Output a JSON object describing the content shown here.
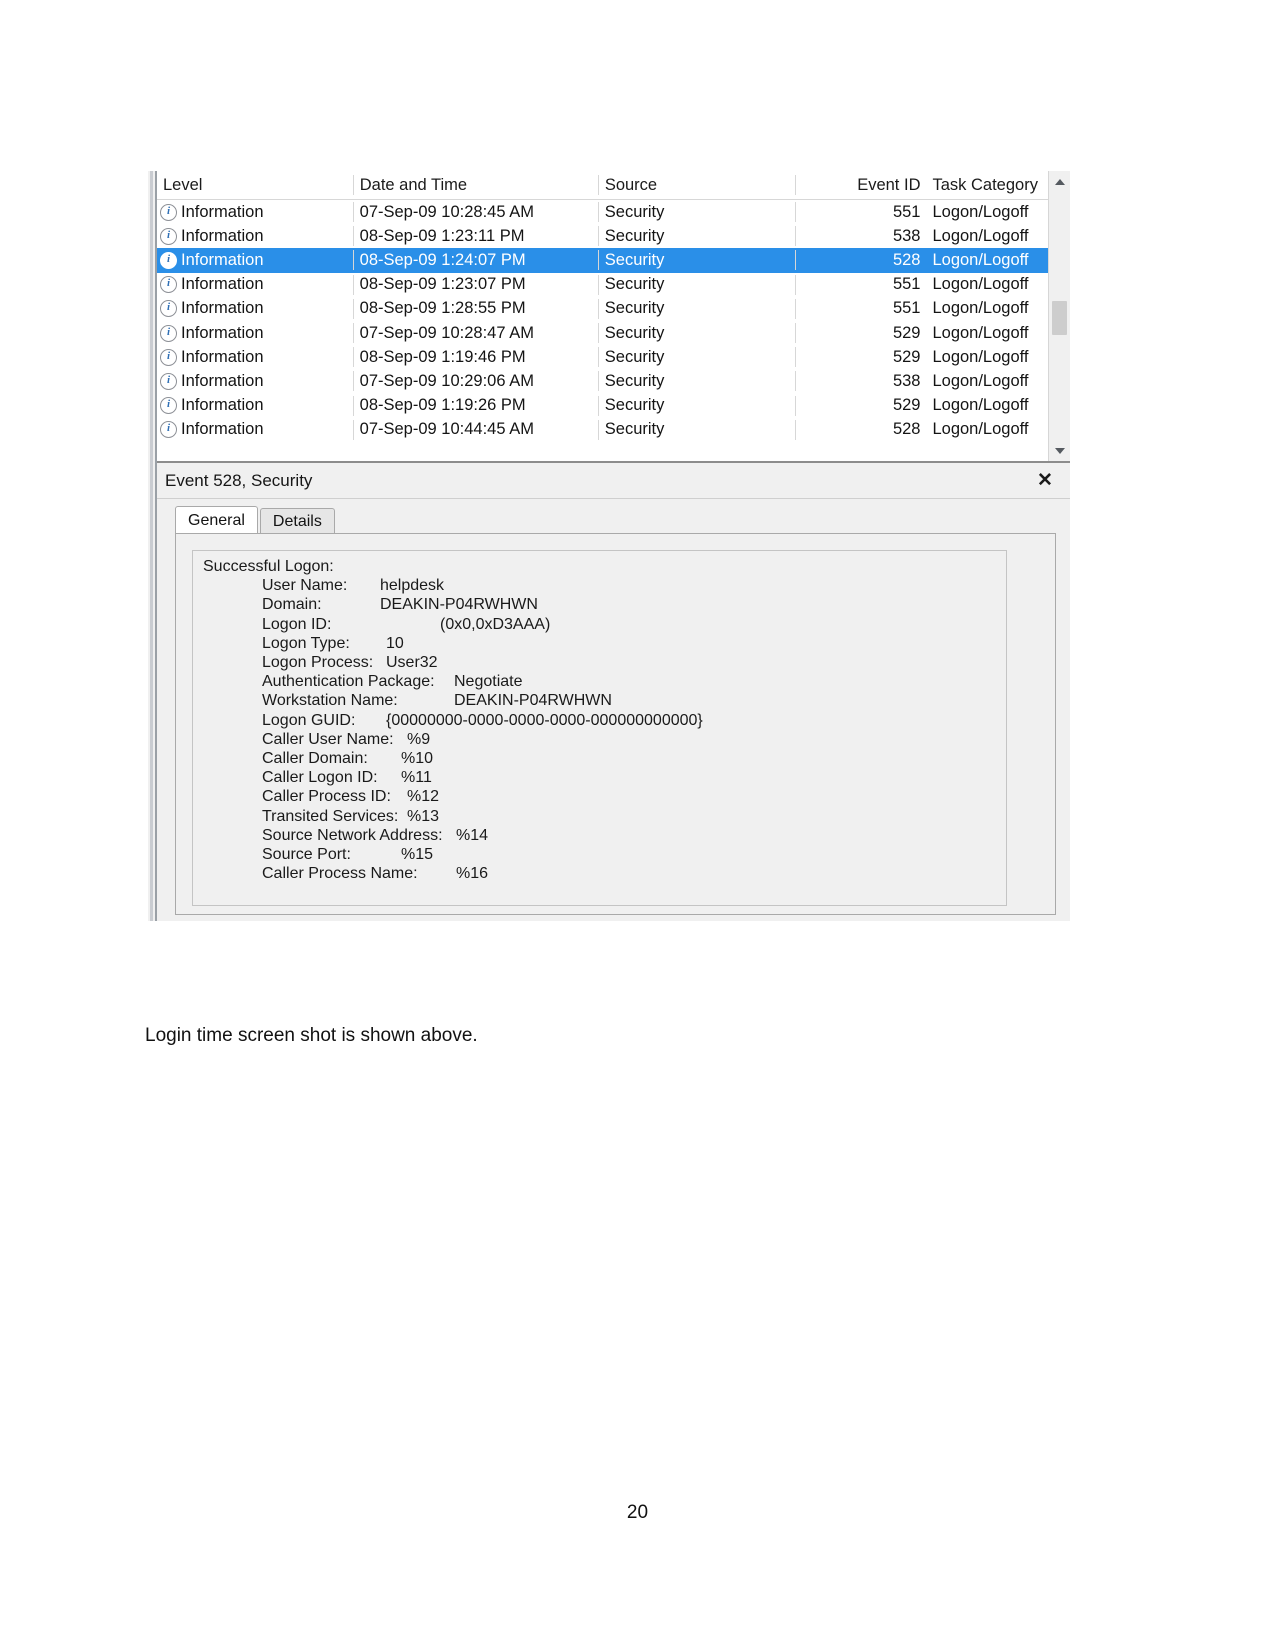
{
  "document": {
    "caption": "Login time screen shot is shown above.",
    "page_number": "20"
  },
  "event_viewer": {
    "list": {
      "columns": {
        "level": "Level",
        "date_time": "Date and Time",
        "source": "Source",
        "event_id": "Event ID",
        "task_category": "Task Category"
      },
      "rows": [
        {
          "level": "Information",
          "date_time": "07-Sep-09 10:28:45 AM",
          "source": "Security",
          "event_id": "551",
          "task_category": "Logon/Logoff",
          "selected": false
        },
        {
          "level": "Information",
          "date_time": "08-Sep-09 1:23:11 PM",
          "source": "Security",
          "event_id": "538",
          "task_category": "Logon/Logoff",
          "selected": false
        },
        {
          "level": "Information",
          "date_time": "08-Sep-09 1:24:07 PM",
          "source": "Security",
          "event_id": "528",
          "task_category": "Logon/Logoff",
          "selected": true
        },
        {
          "level": "Information",
          "date_time": "08-Sep-09 1:23:07 PM",
          "source": "Security",
          "event_id": "551",
          "task_category": "Logon/Logoff",
          "selected": false
        },
        {
          "level": "Information",
          "date_time": "08-Sep-09 1:28:55 PM",
          "source": "Security",
          "event_id": "551",
          "task_category": "Logon/Logoff",
          "selected": false
        },
        {
          "level": "Information",
          "date_time": "07-Sep-09 10:28:47 AM",
          "source": "Security",
          "event_id": "529",
          "task_category": "Logon/Logoff",
          "selected": false
        },
        {
          "level": "Information",
          "date_time": "08-Sep-09 1:19:46 PM",
          "source": "Security",
          "event_id": "529",
          "task_category": "Logon/Logoff",
          "selected": false
        },
        {
          "level": "Information",
          "date_time": "07-Sep-09 10:29:06 AM",
          "source": "Security",
          "event_id": "538",
          "task_category": "Logon/Logoff",
          "selected": false
        },
        {
          "level": "Information",
          "date_time": "08-Sep-09 1:19:26 PM",
          "source": "Security",
          "event_id": "529",
          "task_category": "Logon/Logoff",
          "selected": false
        },
        {
          "level": "Information",
          "date_time": "07-Sep-09 10:44:45 AM",
          "source": "Security",
          "event_id": "528",
          "task_category": "Logon/Logoff",
          "selected": false
        }
      ],
      "scrollbar": {
        "up_arrow": "scroll-up",
        "down_arrow": "scroll-down"
      },
      "level_icon": "i"
    },
    "detail": {
      "title": "Event 528, Security",
      "close_label": "✕",
      "tabs": [
        {
          "label": "General",
          "active": true
        },
        {
          "label": "Details",
          "active": false
        }
      ],
      "heading": "Successful Logon:",
      "fields": [
        {
          "label": "User Name:",
          "value": "helpdesk",
          "label_width": 118,
          "gap": 0
        },
        {
          "label": "Domain:",
          "value": "DEAKIN-P04RWHWN",
          "label_width": 118,
          "gap": 0
        },
        {
          "label": "Logon ID:",
          "value": "(0x0,0xD3AAA)",
          "label_width": 178,
          "gap": 0
        },
        {
          "label": "Logon Type:",
          "value": "10",
          "label_width": 124,
          "gap": 0
        },
        {
          "label": "Logon Process:",
          "value": "User32",
          "label_width": 124,
          "gap": 0
        },
        {
          "label": "Authentication Package:",
          "value": "Negotiate",
          "label_width": 192,
          "gap": 0
        },
        {
          "label": "Workstation Name:",
          "value": "DEAKIN-P04RWHWN",
          "label_width": 192,
          "gap": 0
        },
        {
          "label": "Logon GUID:",
          "value": "{00000000-0000-0000-0000-000000000000}",
          "label_width": 124,
          "gap": 0
        },
        {
          "label": "Caller User Name:",
          "value": "%9",
          "label_width": 145,
          "gap": 0
        },
        {
          "label": "Caller Domain:",
          "value": "%10",
          "label_width": 139,
          "gap": 0
        },
        {
          "label": "Caller Logon ID:",
          "value": "%11",
          "label_width": 139,
          "gap": 0
        },
        {
          "label": "Caller Process ID:",
          "value": "%12",
          "label_width": 145,
          "gap": 0
        },
        {
          "label": "Transited Services:",
          "value": "%13",
          "label_width": 145,
          "gap": 0
        },
        {
          "label": "Source Network Address:",
          "value": "%14",
          "label_width": 194,
          "gap": 0
        },
        {
          "label": "Source Port:",
          "value": "%15",
          "label_width": 139,
          "gap": 0
        },
        {
          "label": "Caller Process Name:",
          "value": "%16",
          "label_width": 194,
          "gap": 0
        }
      ]
    }
  }
}
